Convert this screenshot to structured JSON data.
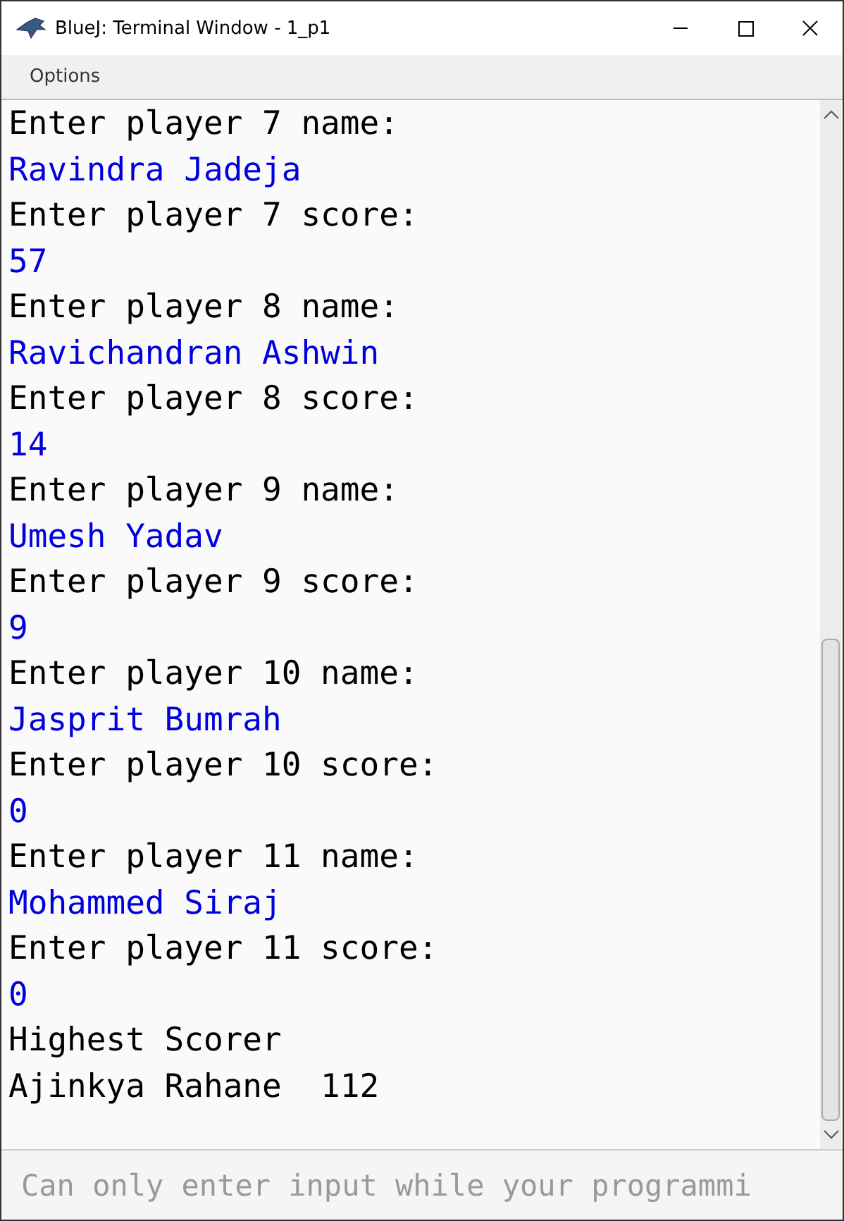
{
  "window": {
    "title": "BlueJ: Terminal Window - 1_p1"
  },
  "menu": [
    "Options"
  ],
  "terminal": {
    "lines": [
      {
        "kind": "prompt",
        "text": "Enter player 7 name:"
      },
      {
        "kind": "input",
        "text": "Ravindra Jadeja"
      },
      {
        "kind": "prompt",
        "text": "Enter player 7 score:"
      },
      {
        "kind": "input",
        "text": "57"
      },
      {
        "kind": "prompt",
        "text": "Enter player 8 name:"
      },
      {
        "kind": "input",
        "text": "Ravichandran Ashwin"
      },
      {
        "kind": "prompt",
        "text": "Enter player 8 score:"
      },
      {
        "kind": "input",
        "text": "14"
      },
      {
        "kind": "prompt",
        "text": "Enter player 9 name:"
      },
      {
        "kind": "input",
        "text": "Umesh Yadav"
      },
      {
        "kind": "prompt",
        "text": "Enter player 9 score:"
      },
      {
        "kind": "input",
        "text": "9"
      },
      {
        "kind": "prompt",
        "text": "Enter player 10 name:"
      },
      {
        "kind": "input",
        "text": "Jasprit Bumrah"
      },
      {
        "kind": "prompt",
        "text": "Enter player 10 score:"
      },
      {
        "kind": "input",
        "text": "0"
      },
      {
        "kind": "prompt",
        "text": "Enter player 11 name:"
      },
      {
        "kind": "input",
        "text": "Mohammed Siraj"
      },
      {
        "kind": "prompt",
        "text": "Enter player 11 score:"
      },
      {
        "kind": "input",
        "text": "0"
      },
      {
        "kind": "prompt",
        "text": "Highest Scorer"
      },
      {
        "kind": "prompt",
        "text": "Ajinkya Rahane  112"
      }
    ]
  },
  "input": {
    "placeholder": "Can only enter input while your programmi"
  }
}
